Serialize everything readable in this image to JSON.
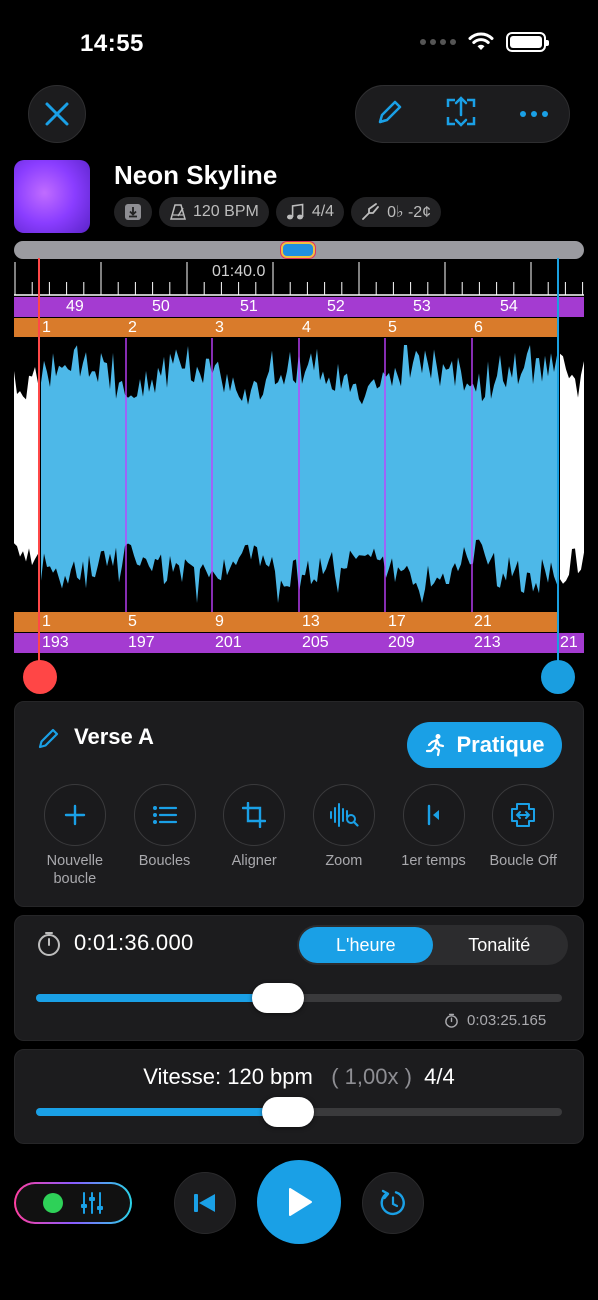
{
  "status": {
    "time": "14:55"
  },
  "song": {
    "title": "Neon Skyline",
    "bpm": "120 BPM",
    "signature": "4/4",
    "tuning": "0♭ -2¢"
  },
  "timeline": {
    "position_label": "01:40.0",
    "bars_top": [
      "49",
      "50",
      "51",
      "52",
      "53",
      "54"
    ],
    "beats_top": [
      "1",
      "2",
      "3",
      "4",
      "5",
      "6"
    ],
    "beats_bottom": [
      "1",
      "5",
      "9",
      "13",
      "17",
      "21"
    ],
    "bars_bottom": [
      "193",
      "197",
      "201",
      "205",
      "209",
      "213",
      "21"
    ]
  },
  "loop": {
    "name": "Verse A",
    "practice_label": "Pratique",
    "tools": [
      {
        "label": "Nouvelle boucle"
      },
      {
        "label": "Boucles"
      },
      {
        "label": "Aligner"
      },
      {
        "label": "Zoom"
      },
      {
        "label": "1er temps"
      },
      {
        "label": "Boucle Off"
      }
    ]
  },
  "transport": {
    "current_time": "0:01:36.000",
    "tab_time": "L'heure",
    "tab_key": "Tonalité",
    "duration": "0:03:25.165",
    "position_fraction": 0.46
  },
  "speed": {
    "label": "Vitesse: 120  bpm",
    "multiplier": "( 1,00x )",
    "signature": "4/4",
    "fraction": 0.48
  },
  "colors": {
    "accent": "#1aa0e6",
    "bars": "#a43bd1",
    "beats": "#d97b2b",
    "waveform": "#4db8e8",
    "loop_start": "#ff4646"
  }
}
